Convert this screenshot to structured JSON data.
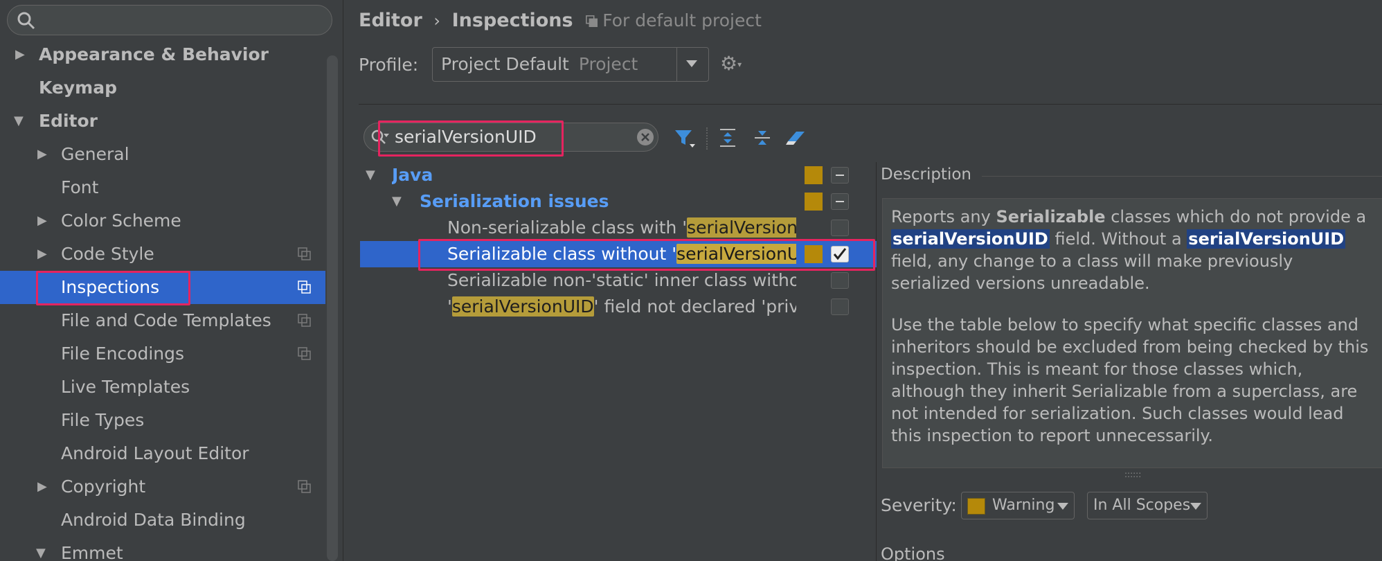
{
  "sidebar": {
    "search": {
      "placeholder": "",
      "icon": "search-icon"
    },
    "items": [
      {
        "label": "Appearance & Behavior",
        "bold": true,
        "expander": "collapsed"
      },
      {
        "label": "Keymap",
        "bold": true
      },
      {
        "label": "Editor",
        "bold": true,
        "expander": "expanded"
      },
      {
        "label": "General",
        "expander": "collapsed"
      },
      {
        "label": "Font"
      },
      {
        "label": "Color Scheme",
        "expander": "collapsed"
      },
      {
        "label": "Code Style",
        "expander": "collapsed",
        "project_icon": true
      },
      {
        "label": "Inspections",
        "selected": true,
        "project_icon": true
      },
      {
        "label": "File and Code Templates",
        "project_icon": true
      },
      {
        "label": "File Encodings",
        "project_icon": true
      },
      {
        "label": "Live Templates"
      },
      {
        "label": "File Types"
      },
      {
        "label": "Android Layout Editor"
      },
      {
        "label": "Copyright",
        "expander": "collapsed",
        "project_icon": true
      },
      {
        "label": "Android Data Binding"
      },
      {
        "label": "Emmet",
        "expander": "expanded"
      }
    ]
  },
  "breadcrumb": {
    "parent": "Editor",
    "separator": "›",
    "current": "Inspections",
    "scope": "For default project"
  },
  "profile": {
    "label": "Profile:",
    "value": "Project Default",
    "sub": "Project"
  },
  "filter": {
    "value": "serialVersionUID"
  },
  "inspections": {
    "group": "Java",
    "subgroup": "Serialization issues",
    "items": [
      {
        "prefix": "Non-serializable class with '",
        "match": "serialVersionU",
        "suffix": "",
        "checked": false
      },
      {
        "prefix": "Serializable class without '",
        "match": "serialVersionUI",
        "suffix": "",
        "checked": true,
        "selected": true
      },
      {
        "prefix": "Serializable non-'static' inner class without",
        "match": "",
        "suffix": "",
        "checked": false
      },
      {
        "prefix": "'",
        "match": "serialVersionUID",
        "suffix": "' field not declared 'priva",
        "checked": false
      }
    ]
  },
  "description": {
    "heading": "Description",
    "p1": {
      "t1": "Reports any ",
      "b1": "Serializable",
      "t2": " classes which do not provide a ",
      "k1": "serialVersionUID",
      "t3": " field. Without a ",
      "k2": "serialVersionUID",
      "t4": " field, any change to a class will make previously serialized versions unreadable."
    },
    "p2": "Use the table below to specify what specific classes and inheritors should be excluded from being checked by this inspection. This is meant for those classes which, although they inherit Serializable from a superclass, are not intended for serialization. Such classes would lead this inspection to report unnecessarily."
  },
  "severity": {
    "label": "Severity:",
    "value": "Warning",
    "swatch_color": "#b5890a",
    "scope": "In All Scopes"
  },
  "options": {
    "label": "Options"
  },
  "colors": {
    "accent": "#2f65ca",
    "highlight_box": "#e5245f",
    "group_text": "#589df6",
    "match_bg": "#b59c3a"
  }
}
